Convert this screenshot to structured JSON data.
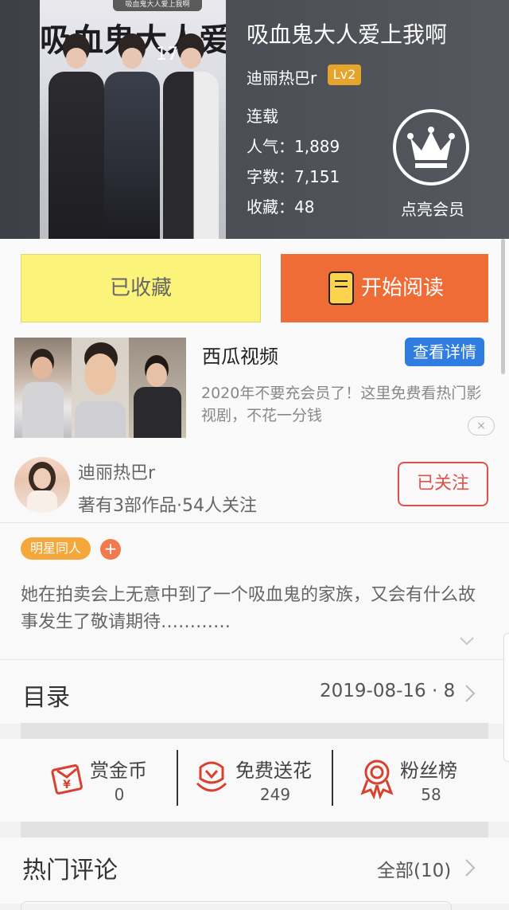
{
  "book": {
    "cover_title_text": "吸血鬼大人爱",
    "cover_banner": "吸血鬼大人爱上我啊",
    "title": "吸血鬼大人爱上我啊",
    "author": "迪丽热巴r",
    "level": "Lv2",
    "status": "连载",
    "popularity": "人气：1,889",
    "word_count": "字数：7,151",
    "collections": "收藏：48",
    "vip_label": "点亮会员"
  },
  "actions": {
    "collect_label": "已收藏",
    "read_label": "开始阅读"
  },
  "ad": {
    "title": "西瓜视频",
    "button": "查看详情",
    "description": "2020年不要充会员了！这里免费看热门影视剧，不花一分钱",
    "close": "×"
  },
  "author_info": {
    "name": "迪丽热巴r",
    "stats": "著有3部作品·54人关注",
    "follow_label": "已关注"
  },
  "tags": {
    "items": [
      "明星同人"
    ],
    "add": "+"
  },
  "description": "她在拍卖会上无意中到了一个吸血鬼的家族，又会有什么故事发生了敬请期待…………",
  "toc": {
    "title": "目录",
    "info": "2019-08-16 · 8"
  },
  "stats": {
    "reward": {
      "label": "赏金币",
      "value": "0"
    },
    "flowers": {
      "label": "免费送花",
      "value": "249"
    },
    "fans": {
      "label": "粉丝榜",
      "value": "58"
    }
  },
  "comments": {
    "title": "热门评论",
    "all": "全部(10)"
  },
  "colors": {
    "accent_orange": "#f06c37",
    "collect_yellow": "#fcf47a",
    "level_badge": "#e5a52d",
    "ad_button": "#2f7de1",
    "follow_red": "#e0504b",
    "icon_red": "#d8412f"
  }
}
